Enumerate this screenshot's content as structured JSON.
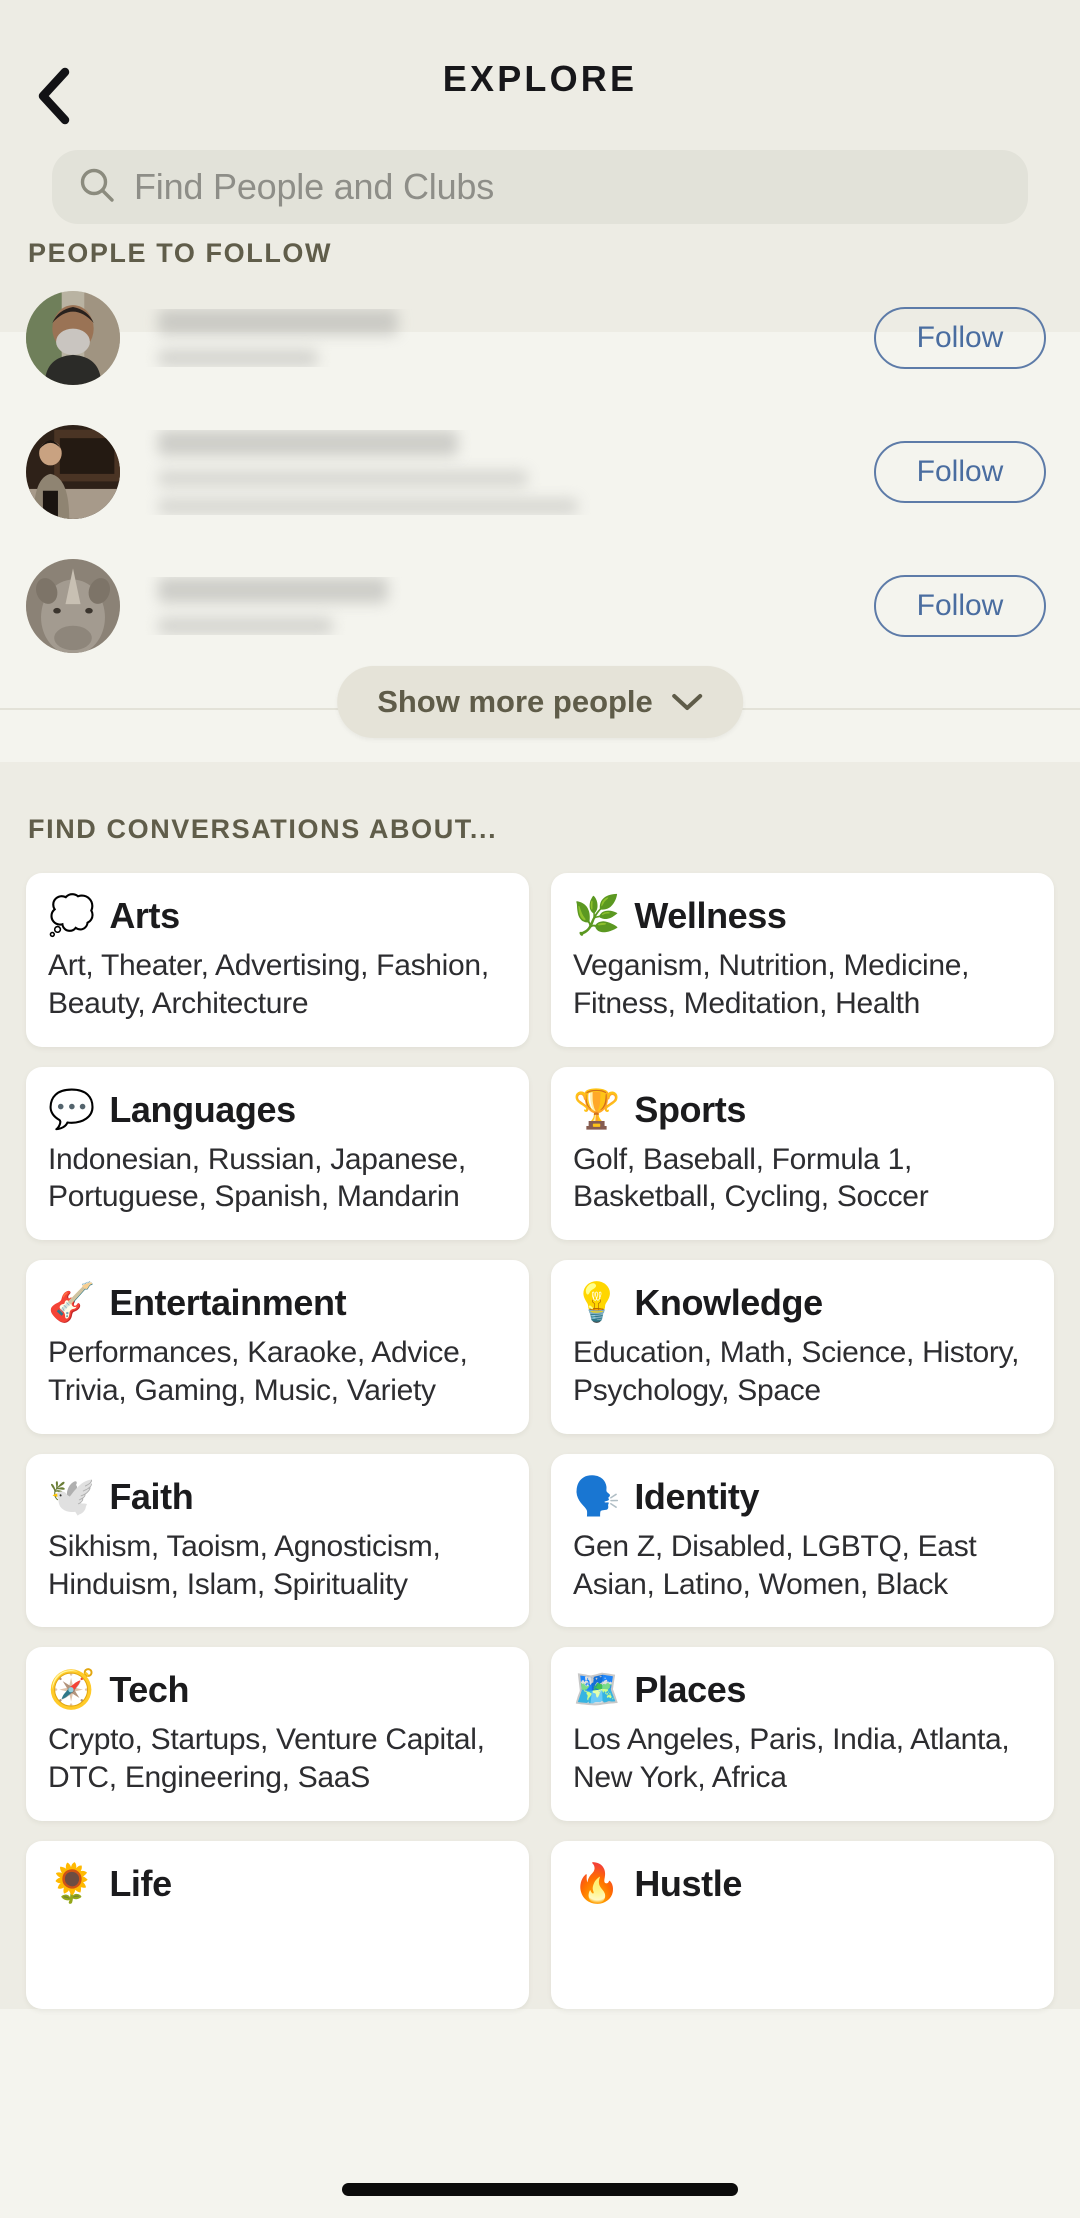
{
  "nav": {
    "back_icon": "chevron-left-icon",
    "title": "EXPLORE"
  },
  "search": {
    "icon": "search-icon",
    "placeholder": "Find People and Clubs",
    "value": ""
  },
  "people_section": {
    "title": "PEOPLE TO FOLLOW",
    "follow_label": "Follow",
    "people": [
      {
        "name": "",
        "handle": "",
        "bio": "",
        "avatar_alt": "bearded-man-photo",
        "redacted": true
      },
      {
        "name": "",
        "handle": "",
        "bio": "",
        "avatar_alt": "person-in-cafe-photo",
        "redacted": true
      },
      {
        "name": "",
        "handle": "",
        "bio": "",
        "avatar_alt": "rhinoceros-photo",
        "redacted": true
      }
    ],
    "show_more_label": "Show more people",
    "show_more_icon": "chevron-down-icon"
  },
  "conversations_section": {
    "title": "FIND CONVERSATIONS ABOUT...",
    "categories": [
      {
        "emoji": "💭",
        "icon_name": "thought-balloon-icon",
        "name": "Arts",
        "topics": "Art, Theater, Advertising, Fashion, Beauty, Architecture"
      },
      {
        "emoji": "🌿",
        "icon_name": "herb-icon",
        "name": "Wellness",
        "topics": "Veganism, Nutrition, Medicine, Fitness, Meditation, Health"
      },
      {
        "emoji": "💬",
        "icon_name": "speech-balloon-icon",
        "name": "Languages",
        "topics": "Indonesian, Russian, Japanese, Portuguese, Spanish, Mandarin"
      },
      {
        "emoji": "🏆",
        "icon_name": "trophy-icon",
        "name": "Sports",
        "topics": "Golf, Baseball, Formula 1, Basketball, Cycling, Soccer"
      },
      {
        "emoji": "🎸",
        "icon_name": "guitar-icon",
        "name": "Entertainment",
        "topics": "Performances, Karaoke, Advice, Trivia, Gaming, Music, Variety"
      },
      {
        "emoji": "💡",
        "icon_name": "light-bulb-icon",
        "name": "Knowledge",
        "topics": "Education, Math, Science, History, Psychology, Space"
      },
      {
        "emoji": "🕊️",
        "icon_name": "dove-icon",
        "name": "Faith",
        "topics": "Sikhism, Taoism, Agnosticism, Hinduism, Islam, Spirituality"
      },
      {
        "emoji": "🗣️",
        "icon_name": "speaking-head-icon",
        "name": "Identity",
        "topics": "Gen Z, Disabled, LGBTQ, East Asian, Latino, Women, Black"
      },
      {
        "emoji": "🧭",
        "icon_name": "compass-icon",
        "name": "Tech",
        "topics": "Crypto, Startups, Venture Capital, DTC, Engineering, SaaS"
      },
      {
        "emoji": "🗺️",
        "icon_name": "world-map-icon",
        "name": "Places",
        "topics": "Los Angeles, Paris, India, Atlanta, New York, Africa"
      },
      {
        "emoji": "🌻",
        "icon_name": "sunflower-icon",
        "name": "Life",
        "topics": ""
      },
      {
        "emoji": "🔥",
        "icon_name": "fire-icon",
        "name": "Hustle",
        "topics": ""
      }
    ]
  },
  "colors": {
    "header_bg": "#edece4",
    "list_bg": "#f4f4ee",
    "search_bg": "#e2e2d9",
    "follow_accent": "#4a6da0",
    "section_label": "#605d4a",
    "card_bg": "#ffffff"
  }
}
